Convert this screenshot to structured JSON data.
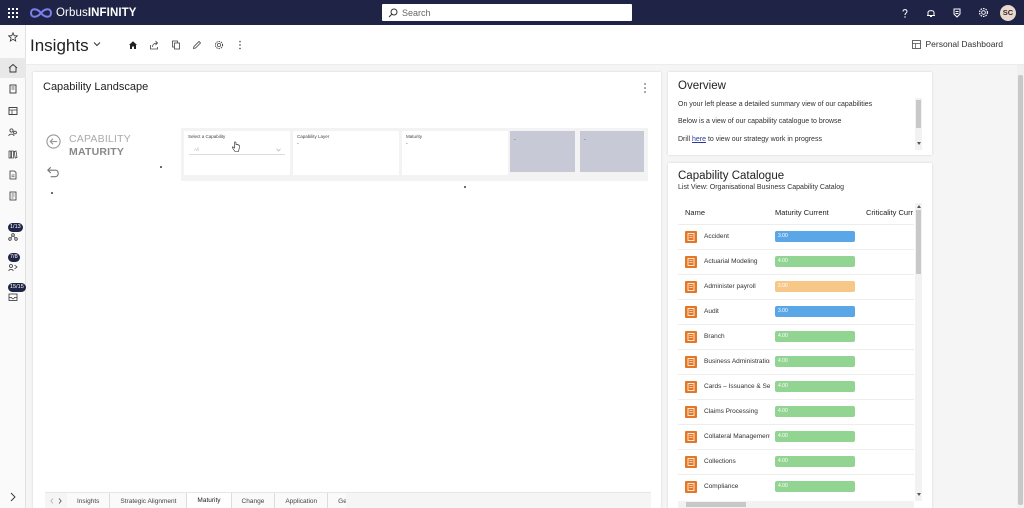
{
  "topbar": {
    "brand_prefix": "Orbus",
    "brand_suffix": "INFINITY",
    "search_placeholder": "Search",
    "avatar_initials": "SC",
    "icons": [
      "help-icon",
      "bell-icon",
      "badge-icon",
      "gear-icon"
    ]
  },
  "rail": {
    "badges": [
      "1/13",
      "7/8",
      "15/15"
    ]
  },
  "page": {
    "title": "Insights",
    "personal_dashboard": "Personal Dashboard"
  },
  "capability_landscape": {
    "title": "Capability Landscape",
    "heading_line1": "CAPABILITY",
    "heading_line2": "MATURITY",
    "filters": {
      "select_capability_label": "Select a Capability",
      "select_capability_value": "All",
      "capability_layer_label": "Capability Layer",
      "capability_layer_value": "-",
      "maturity_label": "Maturity",
      "maturity_value": "-",
      "box4_value": "-",
      "box5_value": "-"
    }
  },
  "tabs": [
    "Insights",
    "Strategic Alignment",
    "Maturity",
    "Change",
    "Application",
    "Ge"
  ],
  "active_tab": "Maturity",
  "overview": {
    "title": "Overview",
    "line1": "On your left please a detailed summary view of our capabilities",
    "line2": "Below is a view of our capability catalogue to browse",
    "line3_prefix": "Drill ",
    "line3_link": "here",
    "line3_suffix": " to view our strategy work in progress"
  },
  "catalogue": {
    "title": "Capability Catalogue",
    "subtitle": "List View: Organisational Business Capability Catalog",
    "columns": [
      "Name",
      "Maturity Current",
      "Criticality Curr"
    ],
    "rows": [
      {
        "name": "Accident",
        "value": "3.00",
        "color": "#5aa6e6"
      },
      {
        "name": "Actuarial Modeling",
        "value": "4.00",
        "color": "#92d492"
      },
      {
        "name": "Administer payroll",
        "value": "2.00",
        "color": "#f7c788"
      },
      {
        "name": "Audit",
        "value": "3.00",
        "color": "#5aa6e6"
      },
      {
        "name": "Branch",
        "value": "4.00",
        "color": "#92d492"
      },
      {
        "name": "Business Administration",
        "value": "4.00",
        "color": "#92d492"
      },
      {
        "name": "Cards – Issuance & Servicing",
        "value": "4.00",
        "color": "#92d492"
      },
      {
        "name": "Claims Processing",
        "value": "4.00",
        "color": "#92d492"
      },
      {
        "name": "Collateral Management",
        "value": "4.00",
        "color": "#92d492"
      },
      {
        "name": "Collections",
        "value": "4.00",
        "color": "#92d492"
      },
      {
        "name": "Compliance",
        "value": "4.00",
        "color": "#92d492"
      }
    ]
  },
  "colors": {
    "topbar": "#1f2446",
    "accent_orange": "#e37726"
  }
}
